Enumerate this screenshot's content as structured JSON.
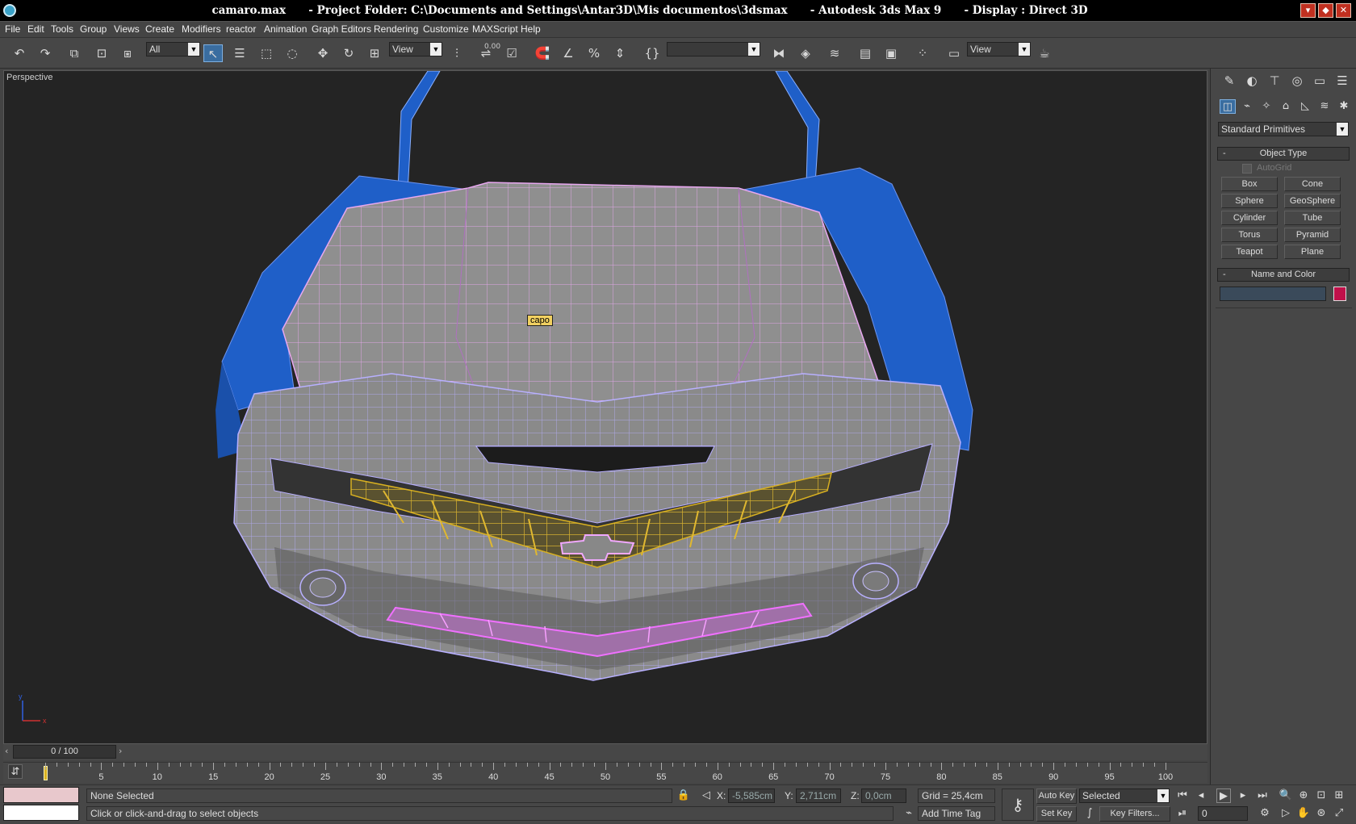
{
  "window": {
    "title": "camaro.max      - Project Folder: C:\\Documents and Settings\\Antar3D\\Mis documentos\\3dsmax      - Autodesk 3ds Max 9      - Display : Direct 3D"
  },
  "menu": [
    "File",
    "Edit",
    "Tools",
    "Group",
    "Views",
    "Create",
    "Modifiers",
    "reactor",
    "Animation",
    "Graph Editors",
    "Rendering",
    "Customize",
    "MAXScript",
    "Help"
  ],
  "toolbar": {
    "selection_filter": "All",
    "ref_coord": "View",
    "snap_label": "0.00",
    "named_selection": "",
    "view_dropdown": "View"
  },
  "viewport": {
    "label": "Perspective",
    "tooltip": "capo",
    "axis_x": "x",
    "axis_y": "y",
    "colors": {
      "background": "#242424",
      "body_blue": "#1f5fc8",
      "surface_gray": "#8f8f8f",
      "wire_pink": "#e8a8f0",
      "grille_yellow": "#d8b020",
      "wire_lilac": "#b8b0ff"
    }
  },
  "command_panel": {
    "category": "Standard Primitives",
    "object_type_title": "Object Type",
    "autogrid": "AutoGrid",
    "buttons": [
      "Box",
      "Cone",
      "Sphere",
      "GeoSphere",
      "Cylinder",
      "Tube",
      "Torus",
      "Pyramid",
      "Teapot",
      "Plane"
    ],
    "name_color_title": "Name and Color",
    "name_value": "",
    "object_color": "#c0104a"
  },
  "timeline": {
    "frame_display": "0 / 100",
    "ticks": [
      "5",
      "10",
      "15",
      "20",
      "25",
      "30",
      "35",
      "40",
      "45",
      "50",
      "55",
      "60",
      "65",
      "70",
      "75",
      "80",
      "85",
      "90",
      "95",
      "100"
    ]
  },
  "status": {
    "selection": "None Selected",
    "prompt": "Click or click-and-drag to select objects",
    "x_label": "X:",
    "x_value": "-5,585cm",
    "y_label": "Y:",
    "y_value": "2,711cm",
    "z_label": "Z:",
    "z_value": "0,0cm",
    "grid": "Grid = 25,4cm",
    "add_time_tag": "Add Time Tag",
    "auto_key": "Auto Key",
    "set_key": "Set Key",
    "key_mode": "Selected",
    "key_filters": "Key Filters...",
    "current_frame": "0"
  }
}
